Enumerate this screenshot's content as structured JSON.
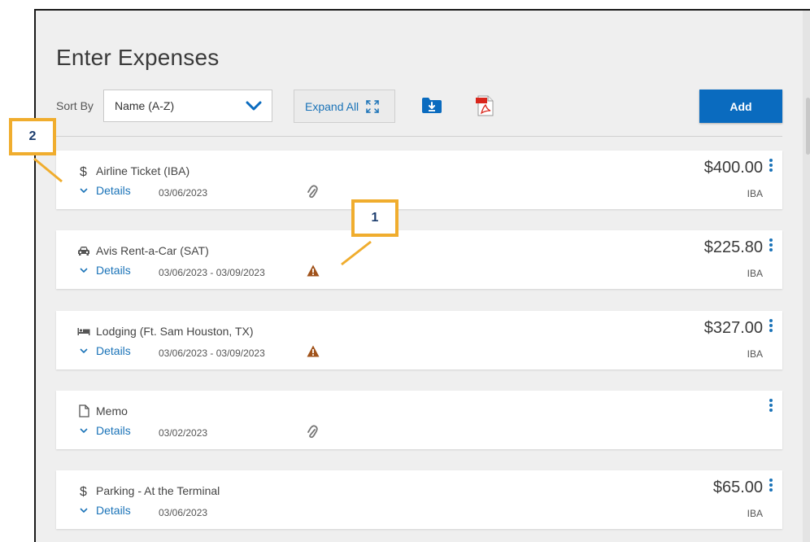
{
  "page": {
    "title": "Enter Expenses"
  },
  "toolbar": {
    "sort_label": "Sort By",
    "sort_value": "Name (A-Z)",
    "expand_all_label": "Expand All",
    "add_label": "Add"
  },
  "icons": {
    "sort_chevron": "chevron-down-icon",
    "expand": "expand-icon",
    "download": "download-folder-icon",
    "pdf": "pdf-icon",
    "attachment": "paperclip-icon",
    "warning": "warning-icon",
    "kebab": "more-vertical-icon"
  },
  "colors": {
    "accent": "#1a73b8",
    "add_button": "#0a6bbf",
    "warning": "#a0521a",
    "callout_border": "#f0ad2e",
    "callout_text": "#1c3d6e"
  },
  "expenses": [
    {
      "type_icon": "dollar-icon",
      "name": "Airline Ticket (IBA)",
      "details_label": "Details",
      "date": "03/06/2023",
      "flag": "attachment",
      "amount": "$400.00",
      "account": "IBA"
    },
    {
      "type_icon": "car-icon",
      "name": "Avis Rent-a-Car (SAT)",
      "details_label": "Details",
      "date": "03/06/2023 - 03/09/2023",
      "flag": "warning",
      "amount": "$225.80",
      "account": "IBA"
    },
    {
      "type_icon": "bed-icon",
      "name": "Lodging (Ft. Sam Houston, TX)",
      "details_label": "Details",
      "date": "03/06/2023 - 03/09/2023",
      "flag": "warning",
      "amount": "$327.00",
      "account": "IBA"
    },
    {
      "type_icon": "document-icon",
      "name": "Memo",
      "details_label": "Details",
      "date": "03/02/2023",
      "flag": "attachment",
      "amount": "",
      "account": ""
    },
    {
      "type_icon": "dollar-icon",
      "name": "Parking - At the Terminal",
      "details_label": "Details",
      "date": "03/06/2023",
      "flag": "",
      "amount": "$65.00",
      "account": "IBA"
    }
  ],
  "callouts": [
    {
      "label": "1"
    },
    {
      "label": "2"
    }
  ]
}
